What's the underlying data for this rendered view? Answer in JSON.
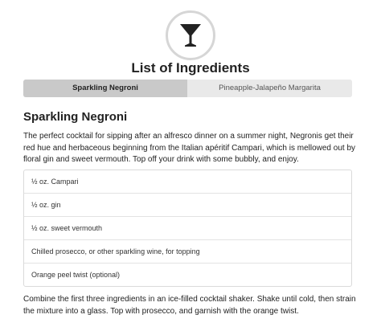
{
  "header": {
    "logo_icon": "cocktail-glass-icon",
    "title": "List of Ingredients"
  },
  "tabs": [
    {
      "label": "Sparkling Negroni",
      "active": true
    },
    {
      "label": "Pineapple-Jalapeño Margarita",
      "active": false
    }
  ],
  "recipe": {
    "title": "Sparkling Negroni",
    "description": "The perfect cocktail for sipping after an alfresco dinner on a summer night, Negronis get their red hue and herbaceous beginning from the Italian apéritif Campari, which is mellowed out by floral gin and sweet vermouth. Top off your drink with some bubbly, and enjoy.",
    "ingredients": [
      "½ oz. Campari",
      "½ oz. gin",
      "½ oz. sweet vermouth",
      "Chilled prosecco, or other sparkling wine, for topping",
      "Orange peel twist (optional)"
    ],
    "instructions": "Combine the first three ingredients in an ice-filled cocktail shaker. Shake until cold, then strain the mixture into a glass. Top with prosecco, and garnish with the orange twist."
  },
  "colors": {
    "active_tab": "#c9c9c9",
    "inactive_tab": "#e9e9e9",
    "logo_ring": "#d6d6d6",
    "icon": "#222222"
  }
}
